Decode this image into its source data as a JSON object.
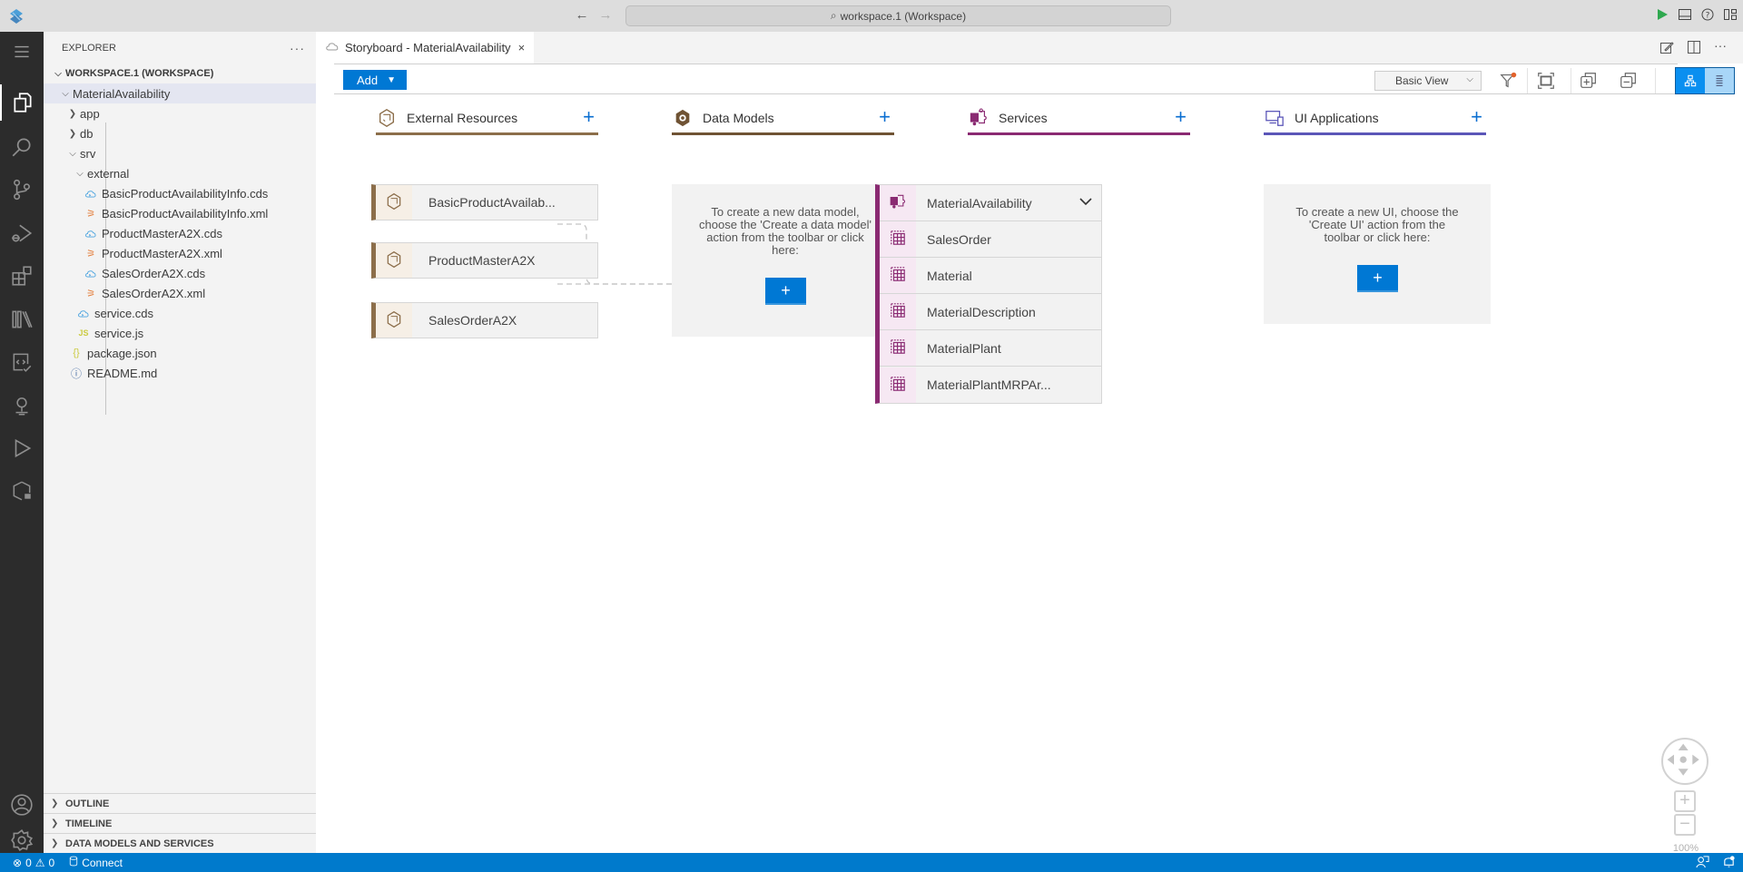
{
  "titlebar": {
    "command_center": "workspace.1 (Workspace)",
    "back_icon": "arrow-left-icon",
    "forward_icon": "arrow-right-icon",
    "actions": [
      "run-icon",
      "toggle-panel-icon",
      "help-icon",
      "customize-layout-icon"
    ]
  },
  "activitybar": {
    "items": [
      {
        "name": "menu",
        "icon": "hamburger-menu-icon"
      },
      {
        "name": "explorer",
        "icon": "files-icon",
        "active": true
      },
      {
        "name": "search",
        "icon": "search-icon"
      },
      {
        "name": "source-control",
        "icon": "source-control-icon"
      },
      {
        "name": "run-debug",
        "icon": "run-debug-icon"
      },
      {
        "name": "extensions",
        "icon": "extensions-icon"
      },
      {
        "name": "library",
        "icon": "library-icon"
      },
      {
        "name": "code-review",
        "icon": "code-check-icon"
      },
      {
        "name": "cloud-foundry",
        "icon": "lightbulb-icon"
      },
      {
        "name": "run-config",
        "icon": "play-icon"
      },
      {
        "name": "service-center",
        "icon": "cube-plug-icon"
      }
    ],
    "bottom": [
      {
        "name": "accounts",
        "icon": "account-icon"
      },
      {
        "name": "manage",
        "icon": "gear-icon"
      }
    ]
  },
  "sidebar": {
    "title": "EXPLORER",
    "more": "···",
    "tree": [
      {
        "label": "WORKSPACE.1 (WORKSPACE)",
        "type": "root",
        "expanded": true,
        "depth": 0
      },
      {
        "label": "MaterialAvailability",
        "type": "folder",
        "expanded": true,
        "depth": 1,
        "selected": true
      },
      {
        "label": "app",
        "type": "folder",
        "expanded": false,
        "depth": 2
      },
      {
        "label": "db",
        "type": "folder",
        "expanded": false,
        "depth": 2
      },
      {
        "label": "srv",
        "type": "folder",
        "expanded": true,
        "depth": 2
      },
      {
        "label": "external",
        "type": "folder",
        "expanded": true,
        "depth": 3
      },
      {
        "label": "BasicProductAvailabilityInfo.cds",
        "type": "cds",
        "depth": 4
      },
      {
        "label": "BasicProductAvailabilityInfo.xml",
        "type": "xml",
        "depth": 4
      },
      {
        "label": "ProductMasterA2X.cds",
        "type": "cds",
        "depth": 4
      },
      {
        "label": "ProductMasterA2X.xml",
        "type": "xml",
        "depth": 4
      },
      {
        "label": "SalesOrderA2X.cds",
        "type": "cds",
        "depth": 4
      },
      {
        "label": "SalesOrderA2X.xml",
        "type": "xml",
        "depth": 4
      },
      {
        "label": "service.cds",
        "type": "cds",
        "depth": 3
      },
      {
        "label": "service.js",
        "type": "js",
        "depth": 3
      },
      {
        "label": "package.json",
        "type": "json",
        "depth": 2
      },
      {
        "label": "README.md",
        "type": "info",
        "depth": 2
      }
    ],
    "sections": [
      "OUTLINE",
      "TIMELINE",
      "DATA MODELS AND SERVICES"
    ]
  },
  "editor": {
    "tab": {
      "label": "Storyboard - MaterialAvailability",
      "icon": "cloud-icon",
      "close": "×"
    },
    "actions": [
      "open-editor-icon",
      "split-editor-icon",
      "more-actions-icon"
    ]
  },
  "toolbar": {
    "add_label": "Add",
    "view_select": "Basic View",
    "icons": [
      "filter-icon",
      "fit-to-screen-icon",
      "expand-all-icon",
      "collapse-all-icon"
    ],
    "toggle": [
      "diagram-view-icon",
      "list-view-icon"
    ]
  },
  "storyboard": {
    "columns": [
      {
        "title": "External Resources",
        "icon": "external-resource-icon",
        "color": "#8c6e4a"
      },
      {
        "title": "Data Models",
        "icon": "data-model-icon",
        "color": "#6f5334"
      },
      {
        "title": "Services",
        "icon": "service-puzzle-icon",
        "color": "#8a2a72"
      },
      {
        "title": "UI Applications",
        "icon": "ui-devices-icon",
        "color": "#5b56b8"
      }
    ],
    "external_resources": [
      "BasicProductAvailab...",
      "ProductMasterA2X",
      "SalesOrderA2X"
    ],
    "data_models_empty": "To create a new data model, choose the 'Create a data model' action from the toolbar or click here:",
    "services": {
      "name": "MaterialAvailability",
      "entities": [
        "SalesOrder",
        "Material",
        "MaterialDescription",
        "MaterialPlant",
        "MaterialPlantMRPAr..."
      ]
    },
    "ui_empty": "To create a new UI, choose the 'Create UI' action from the toolbar or click here:",
    "create_label": "+",
    "add_label": "+"
  },
  "navigation": {
    "zoom_level": "100%",
    "zoom_in": "+",
    "zoom_out": "−"
  },
  "statusbar": {
    "errors": "0",
    "warnings": "0",
    "connect": "Connect",
    "right_icons": [
      "feedback-icon",
      "notifications-icon"
    ]
  },
  "colors": {
    "accent": "#0078d4",
    "statusbar": "#007acc",
    "external": "#8c6e4a",
    "services": "#8a2a72",
    "ui": "#5b56b8"
  }
}
